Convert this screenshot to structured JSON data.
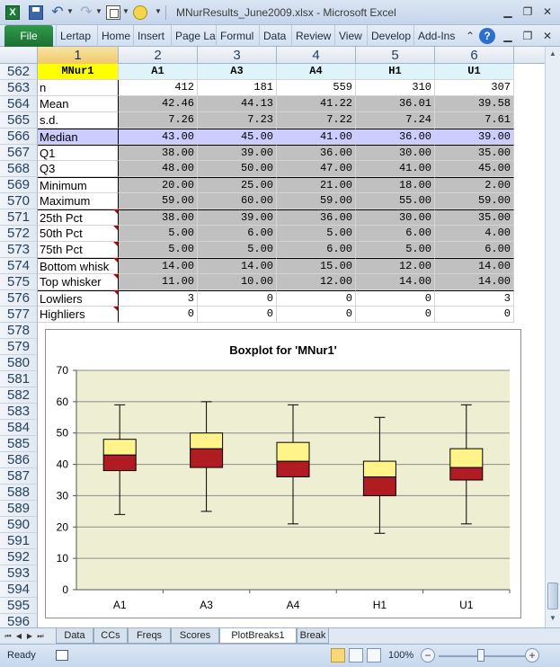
{
  "window": {
    "title": "MNurResults_June2009.xlsx - Microsoft Excel",
    "app_icon_letter": "X"
  },
  "ribbon": {
    "file_label": "File",
    "tabs": [
      "Lertap",
      "Home",
      "Insert",
      "Page La",
      "Formul",
      "Data",
      "Review",
      "View",
      "Develop",
      "Add-Ins"
    ]
  },
  "columns": [
    "1",
    "2",
    "3",
    "4",
    "5",
    "6"
  ],
  "table": {
    "header_row": {
      "row_num": "562",
      "cells": [
        "MNur1",
        "A1",
        "A3",
        "A4",
        "H1",
        "U1"
      ]
    },
    "rows": [
      {
        "row_num": "563",
        "label": "n",
        "values": [
          "412",
          "181",
          "559",
          "310",
          "307"
        ],
        "style": "white"
      },
      {
        "row_num": "564",
        "label": "Mean",
        "values": [
          "42.46",
          "44.13",
          "41.22",
          "36.01",
          "39.58"
        ],
        "style": "gray"
      },
      {
        "row_num": "565",
        "label": "s.d.",
        "values": [
          "7.26",
          "7.23",
          "7.22",
          "7.24",
          "7.61"
        ],
        "style": "gray"
      },
      {
        "row_num": "566",
        "label": "Median",
        "values": [
          "43.00",
          "45.00",
          "41.00",
          "36.00",
          "39.00"
        ],
        "style": "lav"
      },
      {
        "row_num": "567",
        "label": "Q1",
        "values": [
          "38.00",
          "39.00",
          "36.00",
          "30.00",
          "35.00"
        ],
        "style": "gray"
      },
      {
        "row_num": "568",
        "label": "Q3",
        "values": [
          "48.00",
          "50.00",
          "47.00",
          "41.00",
          "45.00"
        ],
        "style": "gray"
      },
      {
        "row_num": "569",
        "label": "Minimum",
        "values": [
          "20.00",
          "25.00",
          "21.00",
          "18.00",
          "2.00"
        ],
        "style": "gray"
      },
      {
        "row_num": "570",
        "label": "Maximum",
        "values": [
          "59.00",
          "60.00",
          "59.00",
          "55.00",
          "59.00"
        ],
        "style": "gray"
      },
      {
        "row_num": "571",
        "label": "25th Pct",
        "values": [
          "38.00",
          "39.00",
          "36.00",
          "30.00",
          "35.00"
        ],
        "style": "gray",
        "flag": true
      },
      {
        "row_num": "572",
        "label": "50th Pct",
        "values": [
          "5.00",
          "6.00",
          "5.00",
          "6.00",
          "4.00"
        ],
        "style": "gray",
        "flag": true
      },
      {
        "row_num": "573",
        "label": "75th Pct",
        "values": [
          "5.00",
          "5.00",
          "6.00",
          "5.00",
          "6.00"
        ],
        "style": "gray",
        "flag": true
      },
      {
        "row_num": "574",
        "label": "Bottom whisk",
        "values": [
          "14.00",
          "14.00",
          "15.00",
          "12.00",
          "14.00"
        ],
        "style": "gray",
        "flag": true
      },
      {
        "row_num": "575",
        "label": "Top whisker",
        "values": [
          "11.00",
          "10.00",
          "12.00",
          "14.00",
          "14.00"
        ],
        "style": "gray",
        "flag": true
      },
      {
        "row_num": "576",
        "label": "Lowliers",
        "values": [
          "3",
          "0",
          "0",
          "0",
          "3"
        ],
        "style": "white",
        "flag": true
      },
      {
        "row_num": "577",
        "label": "Highliers",
        "values": [
          "0",
          "0",
          "0",
          "0",
          "0"
        ],
        "style": "white",
        "flag": true
      }
    ],
    "empty_rows": [
      "578",
      "579",
      "580",
      "581",
      "582",
      "583",
      "584",
      "585",
      "586",
      "587",
      "588",
      "589",
      "590",
      "591",
      "592",
      "593",
      "594",
      "595",
      "596"
    ]
  },
  "chart_data": {
    "type": "boxplot",
    "title": "Boxplot for 'MNur1'",
    "categories": [
      "A1",
      "A3",
      "A4",
      "H1",
      "U1"
    ],
    "ylim": [
      0,
      70
    ],
    "yticks": [
      0,
      10,
      20,
      30,
      40,
      50,
      60,
      70
    ],
    "grid": true,
    "legend": "none",
    "boxes": [
      {
        "category": "A1",
        "q1": 38,
        "median": 43,
        "q3": 48,
        "whisker_low": 24,
        "whisker_high": 59
      },
      {
        "category": "A3",
        "q1": 39,
        "median": 45,
        "q3": 50,
        "whisker_low": 25,
        "whisker_high": 60
      },
      {
        "category": "A4",
        "q1": 36,
        "median": 41,
        "q3": 47,
        "whisker_low": 21,
        "whisker_high": 59
      },
      {
        "category": "H1",
        "q1": 30,
        "median": 36,
        "q3": 41,
        "whisker_low": 18,
        "whisker_high": 55
      },
      {
        "category": "U1",
        "q1": 35,
        "median": 39,
        "q3": 45,
        "whisker_low": 21,
        "whisker_high": 59
      }
    ],
    "colors": {
      "plot_bg": "#eeeed2",
      "lower_box": "#b01c22",
      "upper_box": "#fff38a",
      "grid": "#8c8c8c"
    }
  },
  "sheet_tabs": [
    "Data",
    "CCs",
    "Freqs",
    "Scores",
    "PlotBreaks1",
    "Break"
  ],
  "active_sheet_index": 4,
  "status": {
    "ready": "Ready",
    "zoom": "100%"
  }
}
